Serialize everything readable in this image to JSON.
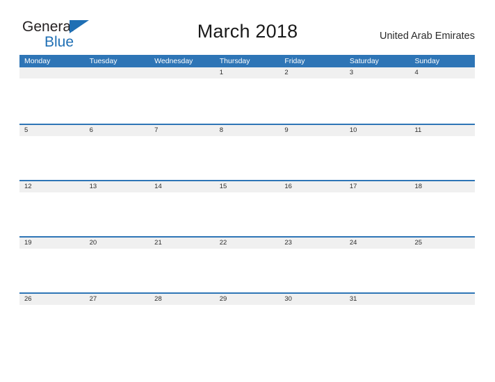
{
  "brand": {
    "name_part1": "General",
    "name_part2": "Blue",
    "logo_icon": "triangle-icon",
    "accent_color": "#1f6fb4"
  },
  "header": {
    "title": "March 2018",
    "region": "United Arab Emirates"
  },
  "calendar": {
    "month": "March",
    "year": "2018",
    "header_bg": "#2e75b6",
    "row_band_bg": "#f0f0f0",
    "weekdays": [
      "Monday",
      "Tuesday",
      "Wednesday",
      "Thursday",
      "Friday",
      "Saturday",
      "Sunday"
    ],
    "weeks": [
      [
        "",
        "",
        "",
        "1",
        "2",
        "3",
        "4"
      ],
      [
        "5",
        "6",
        "7",
        "8",
        "9",
        "10",
        "11"
      ],
      [
        "12",
        "13",
        "14",
        "15",
        "16",
        "17",
        "18"
      ],
      [
        "19",
        "20",
        "21",
        "22",
        "23",
        "24",
        "25"
      ],
      [
        "26",
        "27",
        "28",
        "29",
        "30",
        "31",
        ""
      ]
    ]
  }
}
